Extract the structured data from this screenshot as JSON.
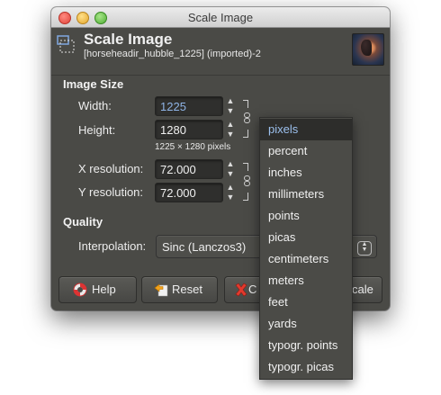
{
  "window": {
    "title": "Scale Image"
  },
  "header": {
    "title": "Scale Image",
    "subtitle": "[horseheadir_hubble_1225] (imported)-2"
  },
  "image_size": {
    "section_label": "Image Size",
    "width_label": "Width:",
    "width_value": "1225",
    "height_label": "Height:",
    "height_value": "1280",
    "dimensions_text": "1225 × 1280 pixels",
    "x_res_label": "X resolution:",
    "x_res_value": "72.000",
    "y_res_label": "Y resolution:",
    "y_res_value": "72.000"
  },
  "quality": {
    "section_label": "Quality",
    "interpolation_label": "Interpolation:",
    "interpolation_value": "Sinc (Lanczos3)"
  },
  "buttons": {
    "help": "Help",
    "reset": "Reset",
    "cancel_partial": "C",
    "scale_partial": "cale"
  },
  "unit_menu": {
    "selected": "pixels",
    "items": [
      "pixels",
      "percent",
      "inches",
      "millimeters",
      "points",
      "picas",
      "centimeters",
      "meters",
      "feet",
      "yards",
      "typogr. points",
      "typogr. picas"
    ]
  },
  "colors": {
    "window_bg": "#4a4a46",
    "field_bg": "#2f2f2d",
    "accent_text": "#8fb4e6",
    "menu_bg": "#4b4b47",
    "menu_selected_bg": "#2d2d2b"
  }
}
